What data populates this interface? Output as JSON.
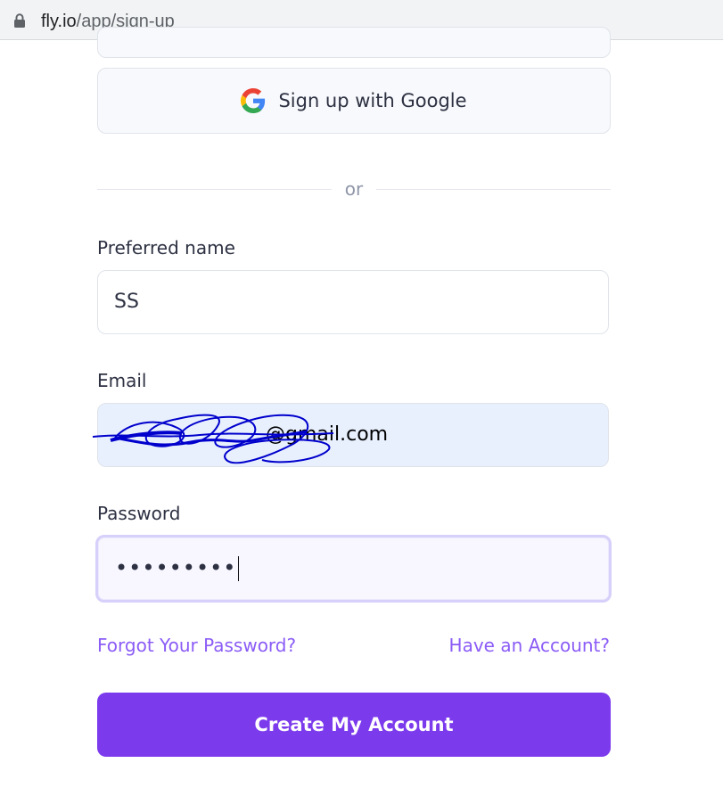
{
  "browser": {
    "url_host": "fly.io",
    "url_path": "/app/sign-up"
  },
  "google_button": {
    "label": "Sign up with Google",
    "icon": "google-icon"
  },
  "divider": {
    "text": "or"
  },
  "form": {
    "preferred_name": {
      "label": "Preferred name",
      "value": "SS"
    },
    "email": {
      "label": "Email",
      "value": "@gmail.com"
    },
    "password": {
      "label": "Password",
      "value": "•••••••••"
    }
  },
  "links": {
    "forgot": "Forgot Your Password?",
    "have_account": "Have an Account?"
  },
  "submit": {
    "label": "Create My Account"
  },
  "colors": {
    "accent": "#7c3aed",
    "link": "#8b5cf6",
    "email_autofill_bg": "#e8f0fe",
    "scribble": "#0000cc"
  }
}
